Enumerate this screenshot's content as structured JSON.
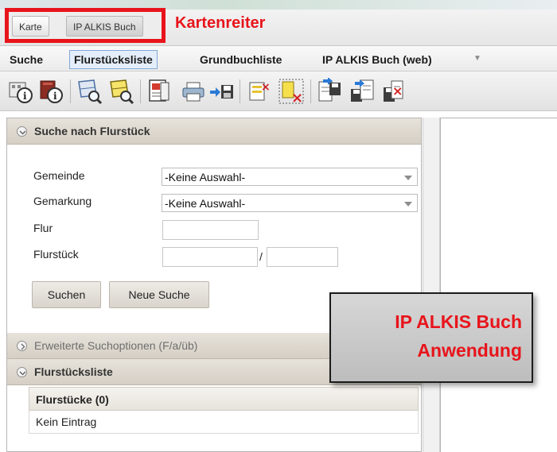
{
  "tabs": {
    "items": [
      {
        "label": "Karte"
      },
      {
        "label": "IP ALKIS Buch"
      }
    ],
    "annotation": "Kartenreiter"
  },
  "menu": {
    "items": [
      {
        "label": "Suche"
      },
      {
        "label": "Flurstücksliste"
      },
      {
        "label": "Grundbuchliste"
      },
      {
        "label": "IP ALKIS Buch (web)"
      }
    ],
    "selected": "Flurstücksliste"
  },
  "toolbar": {
    "icons": [
      "info-building-icon",
      "info-book-icon",
      "search-parcel-icon",
      "search-parcel-yellow-icon",
      "report-icon",
      "print-icon",
      "save-arrow-icon",
      "remove-entry-icon",
      "clear-selection-icon",
      "import-list-icon",
      "export-list-icon",
      "delete-list-icon"
    ]
  },
  "search_section": {
    "title": "Suche nach Flurstück",
    "fields": {
      "gemeinde": {
        "label": "Gemeinde",
        "value": "-Keine Auswahl-"
      },
      "gemarkung": {
        "label": "Gemarkung",
        "value": "-Keine Auswahl-"
      },
      "flur": {
        "label": "Flur",
        "value": ""
      },
      "flurstueck": {
        "label": "Flurstück",
        "separator": "/",
        "value_a": "",
        "value_b": ""
      }
    },
    "buttons": {
      "search": "Suchen",
      "new_search": "Neue Suche"
    }
  },
  "advanced_section": {
    "title": "Erweiterte Suchoptionen  (F/a/üb)"
  },
  "list_section": {
    "title": "Flurstücksliste",
    "column_header": "Flurstücke  (0)",
    "rows": [
      "Kein Eintrag"
    ]
  },
  "annotation": {
    "line1": "IP ALKIS Buch",
    "line2": "Anwendung"
  },
  "colors": {
    "highlight": "#e8141b",
    "selected_menu": "#e4eefa"
  }
}
